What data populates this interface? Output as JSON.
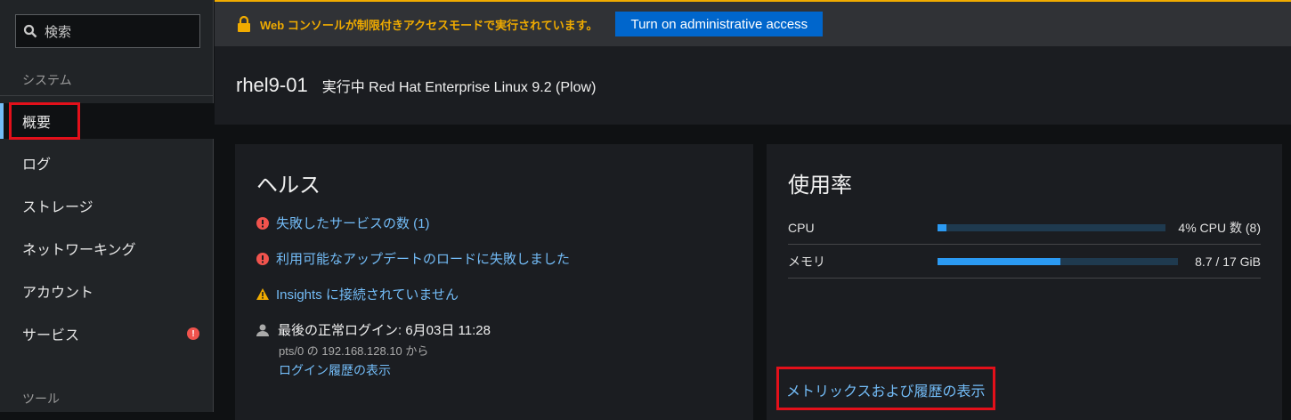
{
  "sidebar": {
    "search_placeholder": "検索",
    "section_system": "システム",
    "items": [
      {
        "label": "概要"
      },
      {
        "label": "ログ"
      },
      {
        "label": "ストレージ"
      },
      {
        "label": "ネットワーキング"
      },
      {
        "label": "アカウント"
      },
      {
        "label": "サービス"
      }
    ],
    "section_tools": "ツール"
  },
  "banner": {
    "message": "Web コンソールが制限付きアクセスモードで実行されています。",
    "button": "Turn on administrative access"
  },
  "header": {
    "hostname": "rhel9-01",
    "status": "実行中 Red Hat Enterprise Linux 9.2 (Plow)"
  },
  "health": {
    "title": "ヘルス",
    "items": [
      "失敗したサービスの数 (1)",
      "利用可能なアップデートのロードに失敗しました",
      "Insights に接続されていません"
    ],
    "login_title": "最後の正常ログイン: 6月03日 11:28",
    "login_detail": "pts/0 の 192.168.128.10 から",
    "login_link": "ログイン履歴の表示"
  },
  "usage": {
    "title": "使用率",
    "cpu_label": "CPU",
    "cpu_value": "4% CPU 数 (8)",
    "cpu_percent": 4,
    "mem_label": "メモリ",
    "mem_value": "8.7 / 17 GiB",
    "mem_percent": 51,
    "link": "メトリックスおよび履歴の表示"
  },
  "colors": {
    "accent": "#73bcf7",
    "warning": "#f0ab00",
    "danger": "#f0534d",
    "highlight": "#e3101a"
  }
}
